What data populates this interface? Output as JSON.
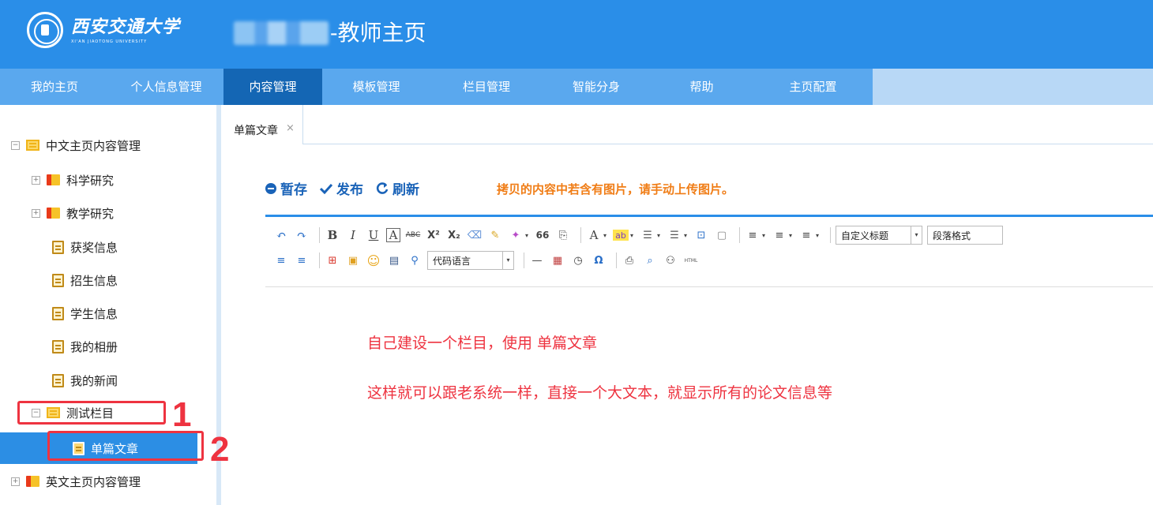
{
  "header": {
    "logo_cn": "西安交通大学",
    "logo_en": "XI'AN JIAOTONG UNIVERSITY",
    "title": "-教师主页"
  },
  "nav": {
    "items": [
      {
        "label": "我的主页"
      },
      {
        "label": "个人信息管理"
      },
      {
        "label": "内容管理"
      },
      {
        "label": "模板管理"
      },
      {
        "label": "栏目管理"
      },
      {
        "label": "智能分身"
      },
      {
        "label": "帮助"
      },
      {
        "label": "主页配置"
      }
    ],
    "active": "内容管理"
  },
  "tree": {
    "root1": "中文主页内容管理",
    "items": [
      {
        "label": "科学研究"
      },
      {
        "label": "教学研究"
      },
      {
        "label": "获奖信息"
      },
      {
        "label": "招生信息"
      },
      {
        "label": "学生信息"
      },
      {
        "label": "我的相册"
      },
      {
        "label": "我的新闻"
      },
      {
        "label": "测试栏目"
      },
      {
        "label": "单篇文章"
      }
    ],
    "root2": "英文主页内容管理",
    "toggle_expanded": "−",
    "toggle_collapsed": "+"
  },
  "annotations": {
    "n1": "1",
    "n2": "2"
  },
  "tab": {
    "label": "单篇文章",
    "close": "×"
  },
  "actions": {
    "save": "暂存",
    "publish": "发布",
    "refresh": "刷新",
    "notice": "拷贝的内容中若含有图片，请手动上传图片。"
  },
  "editor": {
    "custom_title": "自定义标题",
    "paragraph_format": "段落格式",
    "code_language": "代码语言",
    "html_label": "HTML",
    "dropdown_arrow": "▾",
    "glyph": {
      "undo": "↶",
      "redo": "↷",
      "bold": "B",
      "italic": "I",
      "underline": "U",
      "box_a": "A",
      "strike": "ABC",
      "sup": "X²",
      "sub": "X₂",
      "eraser": "⌫",
      "brush": "✎",
      "magic": "✦",
      "quote": "66",
      "paste": "⎘",
      "font_color": "A",
      "highlight": "ab",
      "ol": "☰",
      "ul": "☰",
      "select_all": "⊡",
      "blank": "▢",
      "line_height": "≡",
      "para_spacing": "≡",
      "indent": "≡",
      "align_left": "≡",
      "align_center": "≡",
      "pdf": "⊞",
      "image": "▣",
      "emoticon": "☺",
      "video": "▤",
      "link": "⚲",
      "hr": "—",
      "date": "▦",
      "time": "◷",
      "omega": "Ω",
      "print": "⎙",
      "preview": "⌕",
      "search": "⚇"
    }
  },
  "notes": {
    "line1": "自己建设一个栏目，使用 单篇文章",
    "line2": "这样就可以跟老系统一样，直接一个大文本，就显示所有的论文信息等"
  },
  "colors": {
    "header_bg": "#2a8ee8",
    "nav_bg": "#5aa8ee",
    "nav_active": "#1466b4",
    "selected": "#2c8ee4",
    "annotation_red": "#ee3340",
    "notice_orange": "#f07d16",
    "action_blue": "#1a63b8"
  }
}
